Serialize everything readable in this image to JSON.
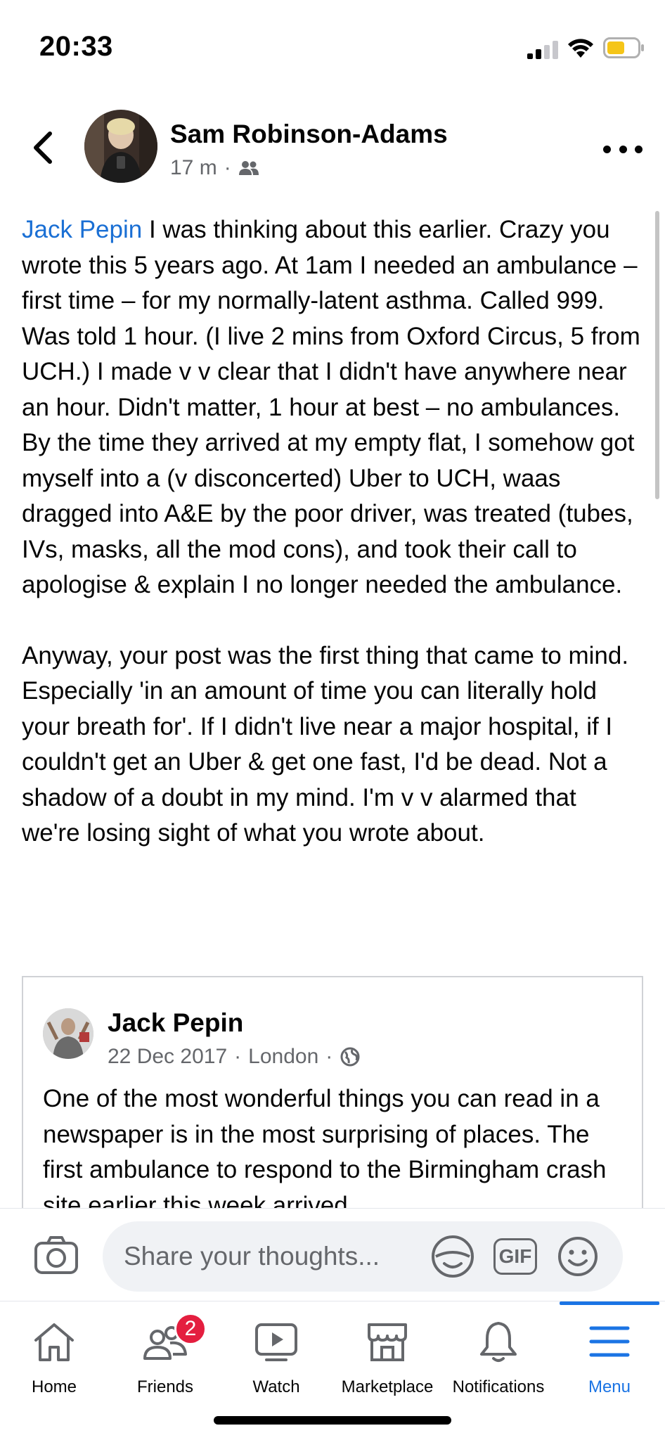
{
  "status_bar": {
    "time": "20:33"
  },
  "post": {
    "author": "Sam Robinson-Adams",
    "time": "17 m",
    "audience_icon": "friends-audience-icon",
    "mention": "Jack Pepin",
    "paragraph1_rest": " I was thinking about this earlier. Crazy you wrote this 5 years ago. At 1am I needed an ambulance – first time – for my normally-latent asthma. Called 999. Was told 1 hour. (I live 2 mins from Oxford Circus, 5 from UCH.) I made v v clear that I didn't have anywhere near an hour. Didn't matter, 1 hour at best – no ambulances. By the time they arrived at my empty flat, I somehow got myself into a (v disconcerted) Uber to UCH, waas dragged into A&E by the poor driver, was treated (tubes, IVs, masks, all the mod cons), and took their call to apologise & explain I no longer needed the ambulance.",
    "paragraph2": "Anyway, your post was the first thing that came to mind. Especially 'in an amount of time you can literally hold your breath for'. If I didn't live near a major hospital, if I couldn't get an Uber & get one fast, I'd be dead. Not a shadow of a doubt in my mind. I'm v v alarmed that we're losing sight of what you wrote about."
  },
  "shared_post": {
    "author": "Jack Pepin",
    "date": "22 Dec 2017",
    "location": "London",
    "audience_icon": "globe-icon",
    "text": "One of the most wonderful things you can read in a newspaper is in the most surprising of places. The first ambulance to respond to the Birmingham crash site earlier this week arrived"
  },
  "composer": {
    "placeholder": "Share your thoughts...",
    "gif_label": "GIF"
  },
  "tabs": [
    {
      "label": "Home",
      "icon": "home-icon"
    },
    {
      "label": "Friends",
      "icon": "friends-icon",
      "badge": "2"
    },
    {
      "label": "Watch",
      "icon": "watch-icon"
    },
    {
      "label": "Marketplace",
      "icon": "marketplace-icon"
    },
    {
      "label": "Notifications",
      "icon": "bell-icon"
    },
    {
      "label": "Menu",
      "icon": "menu-icon",
      "active": true
    }
  ],
  "colors": {
    "link": "#1a6fd4",
    "active_tab": "#1b74e4",
    "badge": "#e41e3f",
    "battery": "#f5c518",
    "secondary_text": "#65676b"
  }
}
